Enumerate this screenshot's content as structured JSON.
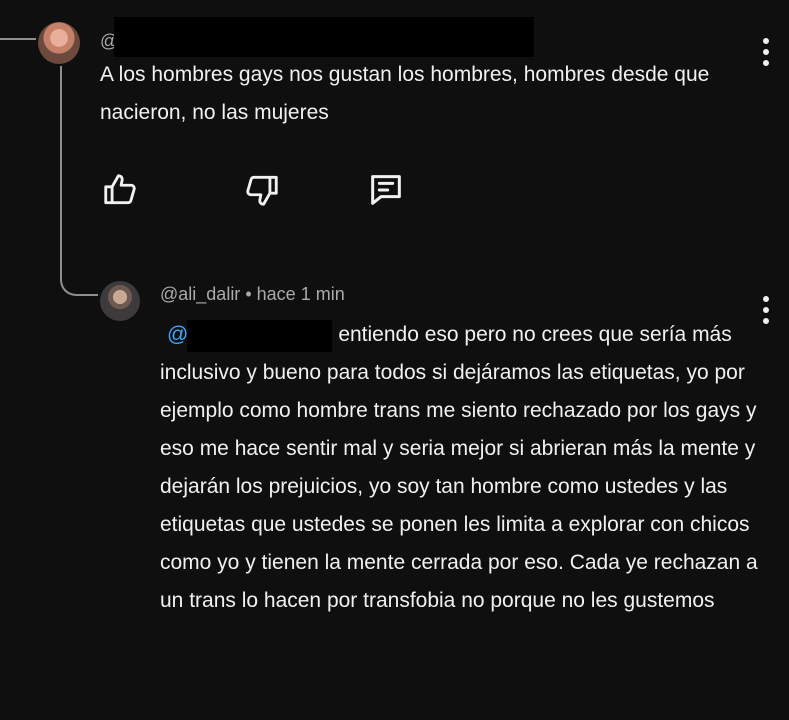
{
  "comment": {
    "handle_prefix": "@",
    "text": "A los hombres gays nos gustan los hombres, hombres desde que nacieron, no las mujeres"
  },
  "reply": {
    "handle": "@ali_dalir",
    "separator": "•",
    "time": "hace 1 min",
    "mention": "@",
    "text": "entiendo eso pero no crees que sería más inclusivo y bueno para todos si dejáramos las etiquetas, yo por ejemplo como hombre trans me siento rechazado por los gays y eso me hace sentir mal y seria mejor si abrieran más la mente y dejarán los prejuicios, yo soy tan hombre como ustedes y las etiquetas que ustedes se ponen les limita a explorar con chicos como yo y tienen la mente cerrada por eso. Cada ye rechazan a un trans lo hacen por transfobia no porque no les gustemos"
  },
  "icons": {
    "like": "thumbs-up-icon",
    "dislike": "thumbs-down-icon",
    "reply": "comment-icon",
    "menu": "more-vertical-icon"
  },
  "colors": {
    "background": "#0f0f0f",
    "text": "#f1f1f1",
    "muted": "#aaaaaa",
    "link": "#3ea6ff"
  }
}
